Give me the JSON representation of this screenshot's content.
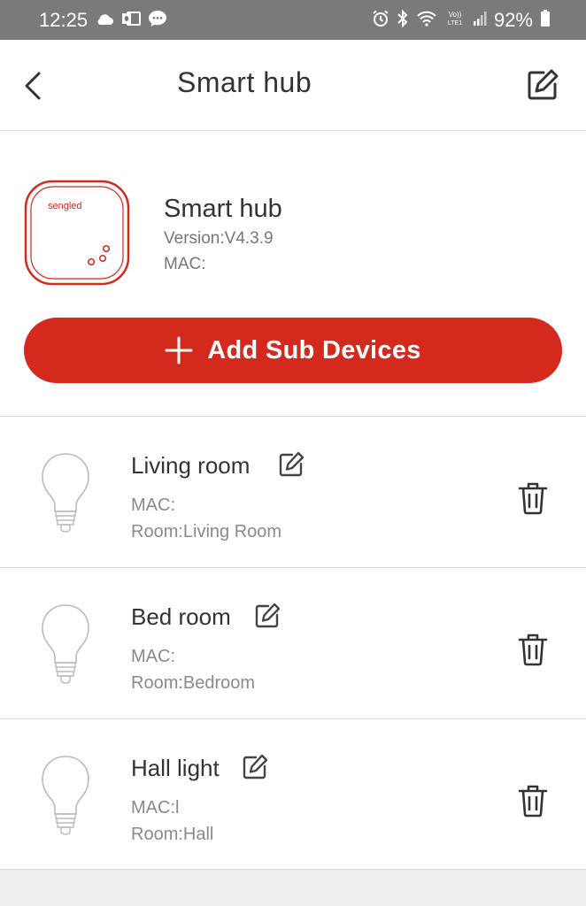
{
  "status_bar": {
    "time": "12:25",
    "battery": "92%",
    "left_icons": [
      "cloud-icon",
      "outlook-icon",
      "message-icon"
    ],
    "right_icons": [
      "alarm-icon",
      "bluetooth-icon",
      "wifi-icon",
      "volte-icon",
      "signal-icon",
      "battery-icon"
    ]
  },
  "header": {
    "title": "Smart hub",
    "back_icon": "chevron-left-icon",
    "edit_icon": "edit-icon"
  },
  "hub": {
    "name": "Smart hub",
    "version": "Version:V4.3.9",
    "mac": "MAC:",
    "brand_logo": "sengled"
  },
  "add_button": {
    "label": "Add Sub Devices"
  },
  "devices": [
    {
      "name": "Living room",
      "mac": "MAC:",
      "room": "Room:Living Room"
    },
    {
      "name": "Bed room",
      "mac": "MAC:",
      "room": "Room:Bedroom"
    },
    {
      "name": "Hall light",
      "mac": "MAC:l",
      "room": "Room:Hall"
    }
  ],
  "colors": {
    "accent": "#d4291d",
    "status_bar": "#7a7a7a",
    "background": "#efefef"
  }
}
